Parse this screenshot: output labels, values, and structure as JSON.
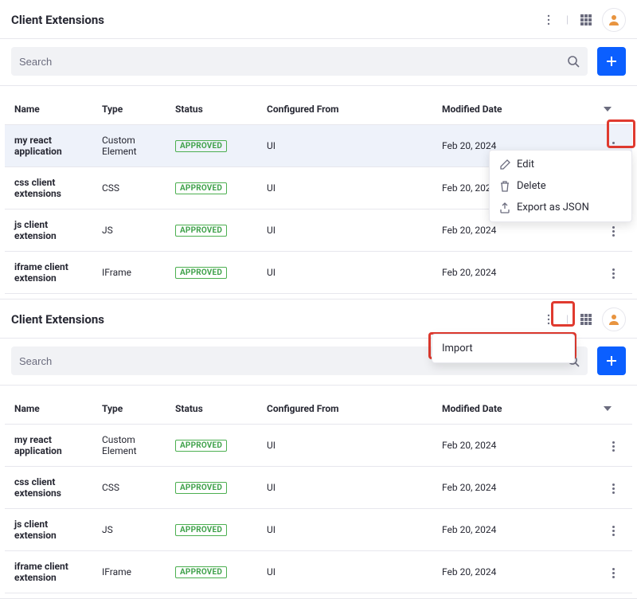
{
  "top": {
    "title": "Client Extensions",
    "search_placeholder": "Search",
    "columns": {
      "name": "Name",
      "type": "Type",
      "status": "Status",
      "configured_from": "Configured From",
      "modified_date": "Modified Date"
    },
    "row_menu": {
      "edit": "Edit",
      "delete": "Delete",
      "export_json": "Export as JSON"
    },
    "rows": [
      {
        "name": "my react application",
        "type": "Custom Element",
        "status": "APPROVED",
        "configured_from": "UI",
        "modified_date": "Feb 20, 2024"
      },
      {
        "name": "css client extensions",
        "type": "CSS",
        "status": "APPROVED",
        "configured_from": "UI",
        "modified_date": "Feb 20, 2024"
      },
      {
        "name": "js client extension",
        "type": "JS",
        "status": "APPROVED",
        "configured_from": "UI",
        "modified_date": "Feb 20, 2024"
      },
      {
        "name": "iframe client extension",
        "type": "IFrame",
        "status": "APPROVED",
        "configured_from": "UI",
        "modified_date": "Feb 20, 2024"
      }
    ]
  },
  "bottom": {
    "title": "Client Extensions",
    "search_placeholder": "Search",
    "header_menu": {
      "import": "Import"
    },
    "columns": {
      "name": "Name",
      "type": "Type",
      "status": "Status",
      "configured_from": "Configured From",
      "modified_date": "Modified Date"
    },
    "rows": [
      {
        "name": "my react application",
        "type": "Custom Element",
        "status": "APPROVED",
        "configured_from": "UI",
        "modified_date": "Feb 20, 2024"
      },
      {
        "name": "css client extensions",
        "type": "CSS",
        "status": "APPROVED",
        "configured_from": "UI",
        "modified_date": "Feb 20, 2024"
      },
      {
        "name": "js client extension",
        "type": "JS",
        "status": "APPROVED",
        "configured_from": "UI",
        "modified_date": "Feb 20, 2024"
      },
      {
        "name": "iframe client extension",
        "type": "IFrame",
        "status": "APPROVED",
        "configured_from": "UI",
        "modified_date": "Feb 20, 2024"
      }
    ]
  }
}
